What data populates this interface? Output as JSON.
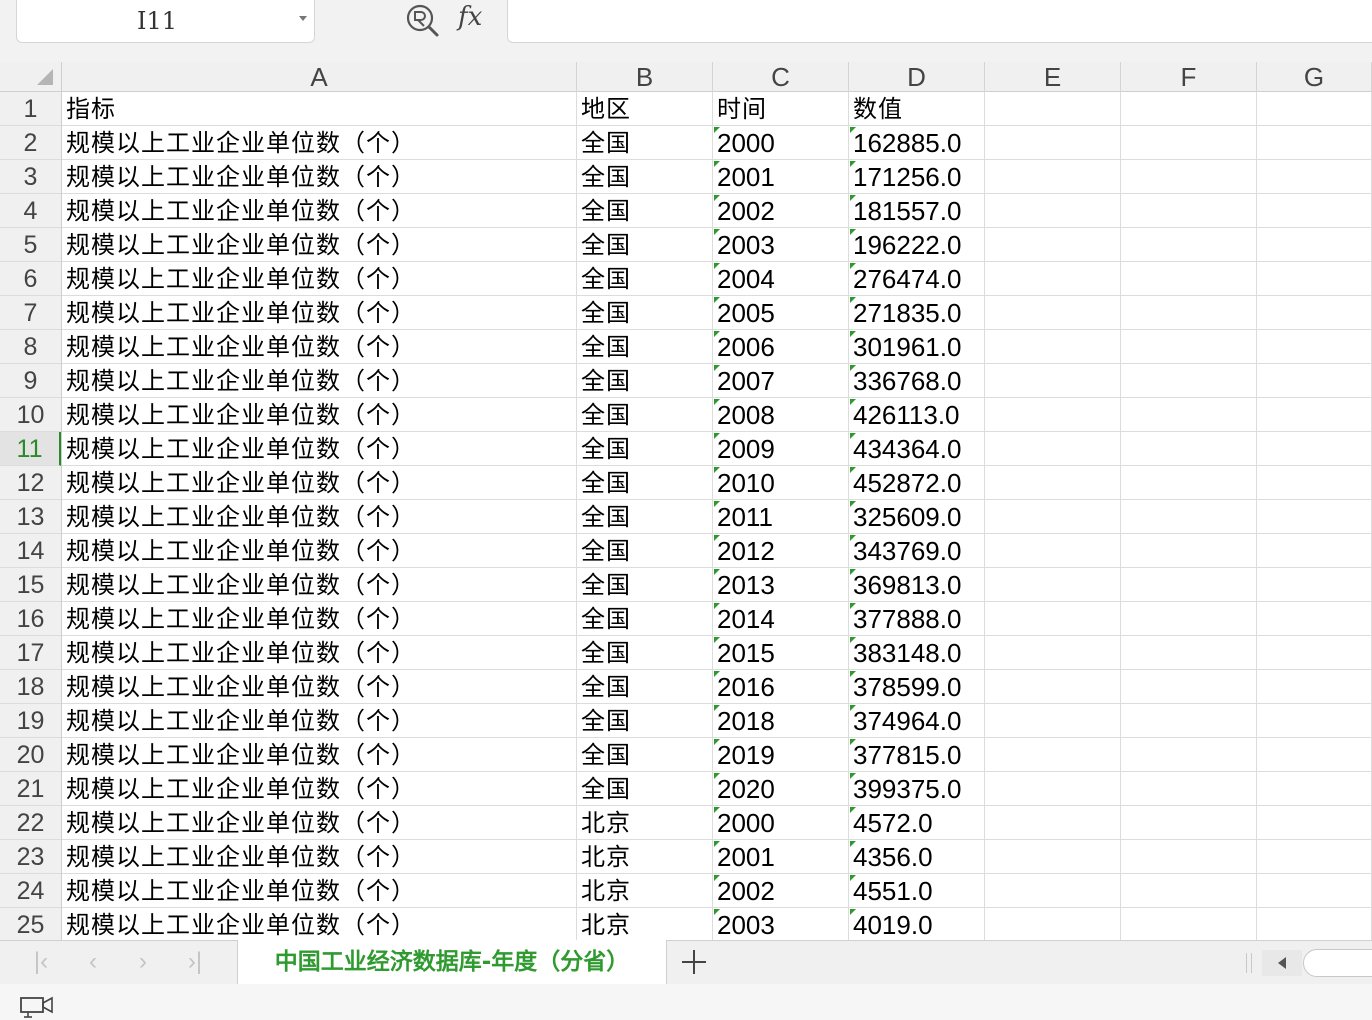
{
  "formula_bar": {
    "name_box": "I11",
    "fx_label": "fx",
    "formula": ""
  },
  "columns": [
    "A",
    "B",
    "C",
    "D",
    "E",
    "F",
    "G"
  ],
  "active_row": 11,
  "rows": [
    {
      "n": "1",
      "a": "指标",
      "b": "地区",
      "c": "时间",
      "d": "数值",
      "header": true
    },
    {
      "n": "2",
      "a": "规模以上工业企业单位数（个）",
      "b": "全国",
      "c": "2000",
      "d": "162885.0"
    },
    {
      "n": "3",
      "a": "规模以上工业企业单位数（个）",
      "b": "全国",
      "c": "2001",
      "d": "171256.0"
    },
    {
      "n": "4",
      "a": "规模以上工业企业单位数（个）",
      "b": "全国",
      "c": "2002",
      "d": "181557.0"
    },
    {
      "n": "5",
      "a": "规模以上工业企业单位数（个）",
      "b": "全国",
      "c": "2003",
      "d": "196222.0"
    },
    {
      "n": "6",
      "a": "规模以上工业企业单位数（个）",
      "b": "全国",
      "c": "2004",
      "d": "276474.0"
    },
    {
      "n": "7",
      "a": "规模以上工业企业单位数（个）",
      "b": "全国",
      "c": "2005",
      "d": "271835.0"
    },
    {
      "n": "8",
      "a": "规模以上工业企业单位数（个）",
      "b": "全国",
      "c": "2006",
      "d": "301961.0"
    },
    {
      "n": "9",
      "a": "规模以上工业企业单位数（个）",
      "b": "全国",
      "c": "2007",
      "d": "336768.0"
    },
    {
      "n": "10",
      "a": "规模以上工业企业单位数（个）",
      "b": "全国",
      "c": "2008",
      "d": "426113.0"
    },
    {
      "n": "11",
      "a": "规模以上工业企业单位数（个）",
      "b": "全国",
      "c": "2009",
      "d": "434364.0"
    },
    {
      "n": "12",
      "a": "规模以上工业企业单位数（个）",
      "b": "全国",
      "c": "2010",
      "d": "452872.0"
    },
    {
      "n": "13",
      "a": "规模以上工业企业单位数（个）",
      "b": "全国",
      "c": "2011",
      "d": "325609.0"
    },
    {
      "n": "14",
      "a": "规模以上工业企业单位数（个）",
      "b": "全国",
      "c": "2012",
      "d": "343769.0"
    },
    {
      "n": "15",
      "a": "规模以上工业企业单位数（个）",
      "b": "全国",
      "c": "2013",
      "d": "369813.0"
    },
    {
      "n": "16",
      "a": "规模以上工业企业单位数（个）",
      "b": "全国",
      "c": "2014",
      "d": "377888.0"
    },
    {
      "n": "17",
      "a": "规模以上工业企业单位数（个）",
      "b": "全国",
      "c": "2015",
      "d": "383148.0"
    },
    {
      "n": "18",
      "a": "规模以上工业企业单位数（个）",
      "b": "全国",
      "c": "2016",
      "d": "378599.0"
    },
    {
      "n": "19",
      "a": "规模以上工业企业单位数（个）",
      "b": "全国",
      "c": "2018",
      "d": "374964.0"
    },
    {
      "n": "20",
      "a": "规模以上工业企业单位数（个）",
      "b": "全国",
      "c": "2019",
      "d": "377815.0"
    },
    {
      "n": "21",
      "a": "规模以上工业企业单位数（个）",
      "b": "全国",
      "c": "2020",
      "d": "399375.0"
    },
    {
      "n": "22",
      "a": "规模以上工业企业单位数（个）",
      "b": "北京",
      "c": "2000",
      "d": "4572.0"
    },
    {
      "n": "23",
      "a": "规模以上工业企业单位数（个）",
      "b": "北京",
      "c": "2001",
      "d": "4356.0"
    },
    {
      "n": "24",
      "a": "规模以上工业企业单位数（个）",
      "b": "北京",
      "c": "2002",
      "d": "4551.0"
    },
    {
      "n": "25",
      "a": "规模以上工业企业单位数（个）",
      "b": "北京",
      "c": "2003",
      "d": "4019.0"
    }
  ],
  "sheet_tab": {
    "label": "中国工业经济数据库-年度（分省）",
    "color": "#2f9a2f"
  },
  "icons": {
    "zoom": "zoom-formula-icon",
    "add_sheet": "plus-icon",
    "macro": "macro-record-icon"
  },
  "colors": {
    "accent": "#2b8a2b",
    "text_number_marker": "#2e9a2e"
  }
}
